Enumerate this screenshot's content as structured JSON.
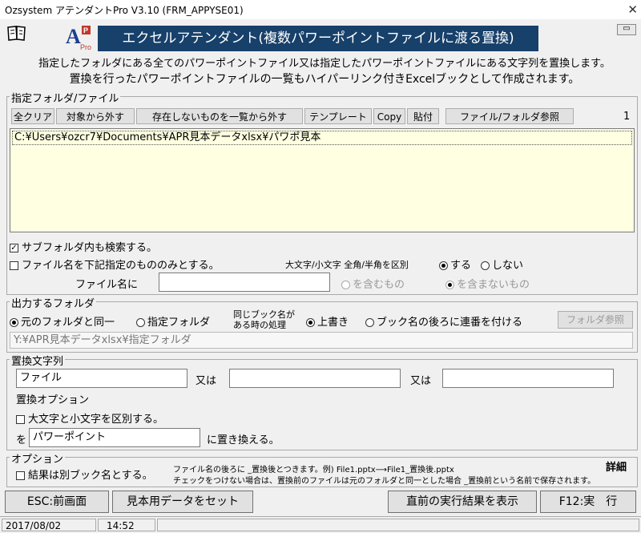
{
  "window": {
    "title": "Ozsystem アテンダントPro V3.10 (FRM_APPYSE01)",
    "close_glyph": "✕",
    "banner_title": "エクセルアテンダント(複数パワーポイントファイルに渡る置換)",
    "banner_color": "#17406a",
    "description_line1": "指定したフォルダにある全てのパワーポイントファイル又は指定したパワーポイントファイルにある文字列を置換します。",
    "description_line2": "置換を行ったパワーポイントファイルの一覧もハイパーリンク付きExcelブックとして作成されます。"
  },
  "folder_section": {
    "label": "指定フォルダ/ファイル",
    "buttons": {
      "clear_all": "全クリア",
      "exclude": "対象から外す",
      "exclude_missing": "存在しないものを一覧から外す",
      "template": "テンプレート",
      "copy": "Copy",
      "paste": "貼付",
      "browse": "ファイル/フォルダ参照"
    },
    "count": "1",
    "list_items": [
      "C:¥Users¥ozcr7¥Documents¥APR見本データxlsx¥パワポ見本"
    ],
    "include_subfolders_label": "サブフォルダ内も検索する。",
    "include_subfolders_checked": true,
    "filter_filename_label": "ファイル名を下記指定のもののみとする。",
    "case_label": "大文字/小文字 全角/半角を区別",
    "case_yes": "する",
    "case_no": "しない",
    "filename_label": "ファイル名に",
    "filename_value": "",
    "contains_label": "を含むもの",
    "not_contains_label": "を含まないもの"
  },
  "output_section": {
    "label": "出力するフォルダ",
    "same_folder": "元のフォルダと同一",
    "specified_folder": "指定フォルダ",
    "same_name_label_1": "同じブック名が",
    "same_name_label_2": "ある時の処理",
    "overwrite": "上書き",
    "append_number": "ブック名の後ろに連番を付ける",
    "folder_browse": "フォルダ参照",
    "path_value": "Y:¥APR見本データxlsx¥指定フォルダ"
  },
  "replace_section": {
    "label": "置換文字列",
    "search_1": "ファイル",
    "or_1": "又は",
    "search_2": "",
    "or_2": "又は",
    "search_3": "",
    "options_label": "置換オプション",
    "case_sensitive_label": "大文字と小文字を区別する。",
    "with_label": "を",
    "replacement_value": "パワーポイント",
    "replace_suffix": "に置き換える。"
  },
  "options_section": {
    "label": "オプション",
    "separate_book_label": "結果は別ブック名とする。",
    "note_line1": "ファイル名の後ろに _置換後とつきます。例) File1.pptx⟶File1_置換後.pptx",
    "note_line2": "チェックをつけない場合は、置換前のファイルは元のフォルダと同一とした場合 _置換前という名前で保存されます。",
    "details": "詳細"
  },
  "bottom_buttons": {
    "esc": "ESC:前画面",
    "sample": "見本用データをセット",
    "last_result": "直前の実行結果を表示",
    "f12": "F12:実　行"
  },
  "status_bar": {
    "date": "2017/08/02",
    "time": "14:52"
  }
}
